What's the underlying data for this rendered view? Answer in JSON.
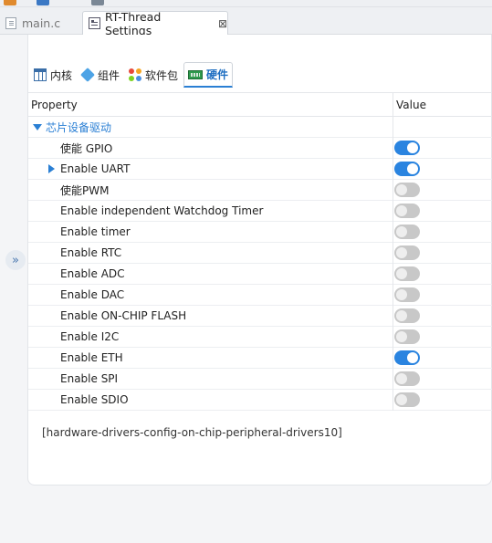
{
  "editor_tabs": {
    "main_tab": "main.c",
    "settings_tab": "RT-Thread Settings",
    "close_symbol": "⊠"
  },
  "sub_tabs": [
    {
      "label": "内核",
      "icon": "kernel-icon"
    },
    {
      "label": "组件",
      "icon": "component-icon"
    },
    {
      "label": "软件包",
      "icon": "package-icon"
    },
    {
      "label": "硬件",
      "icon": "hardware-icon",
      "selected": true
    }
  ],
  "grid": {
    "col_property": "Property",
    "col_value": "Value",
    "category": "芯片设备驱动",
    "items": [
      {
        "label": "使能 GPIO",
        "enabled": true,
        "expandable": false
      },
      {
        "label": "Enable UART",
        "enabled": true,
        "expandable": true
      },
      {
        "label": "使能PWM",
        "enabled": false,
        "expandable": false
      },
      {
        "label": "Enable independent Watchdog Timer",
        "enabled": false,
        "expandable": false
      },
      {
        "label": "Enable timer",
        "enabled": false,
        "expandable": false
      },
      {
        "label": "Enable RTC",
        "enabled": false,
        "expandable": false
      },
      {
        "label": "Enable ADC",
        "enabled": false,
        "expandable": false
      },
      {
        "label": "Enable DAC",
        "enabled": false,
        "expandable": false
      },
      {
        "label": "Enable ON-CHIP FLASH",
        "enabled": false,
        "expandable": false
      },
      {
        "label": "Enable I2C",
        "enabled": false,
        "expandable": false
      },
      {
        "label": "Enable ETH",
        "enabled": true,
        "expandable": false
      },
      {
        "label": "Enable SPI",
        "enabled": false,
        "expandable": false
      },
      {
        "label": "Enable SDIO",
        "enabled": false,
        "expandable": false
      }
    ]
  },
  "description": "[hardware-drivers-config-on-chip-peripheral-drivers10]",
  "side_toggle_symbol": "»",
  "colors": {
    "accent": "#2a84e0",
    "toggle_off": "#c8c8c8",
    "category_text": "#2a7fd4"
  }
}
